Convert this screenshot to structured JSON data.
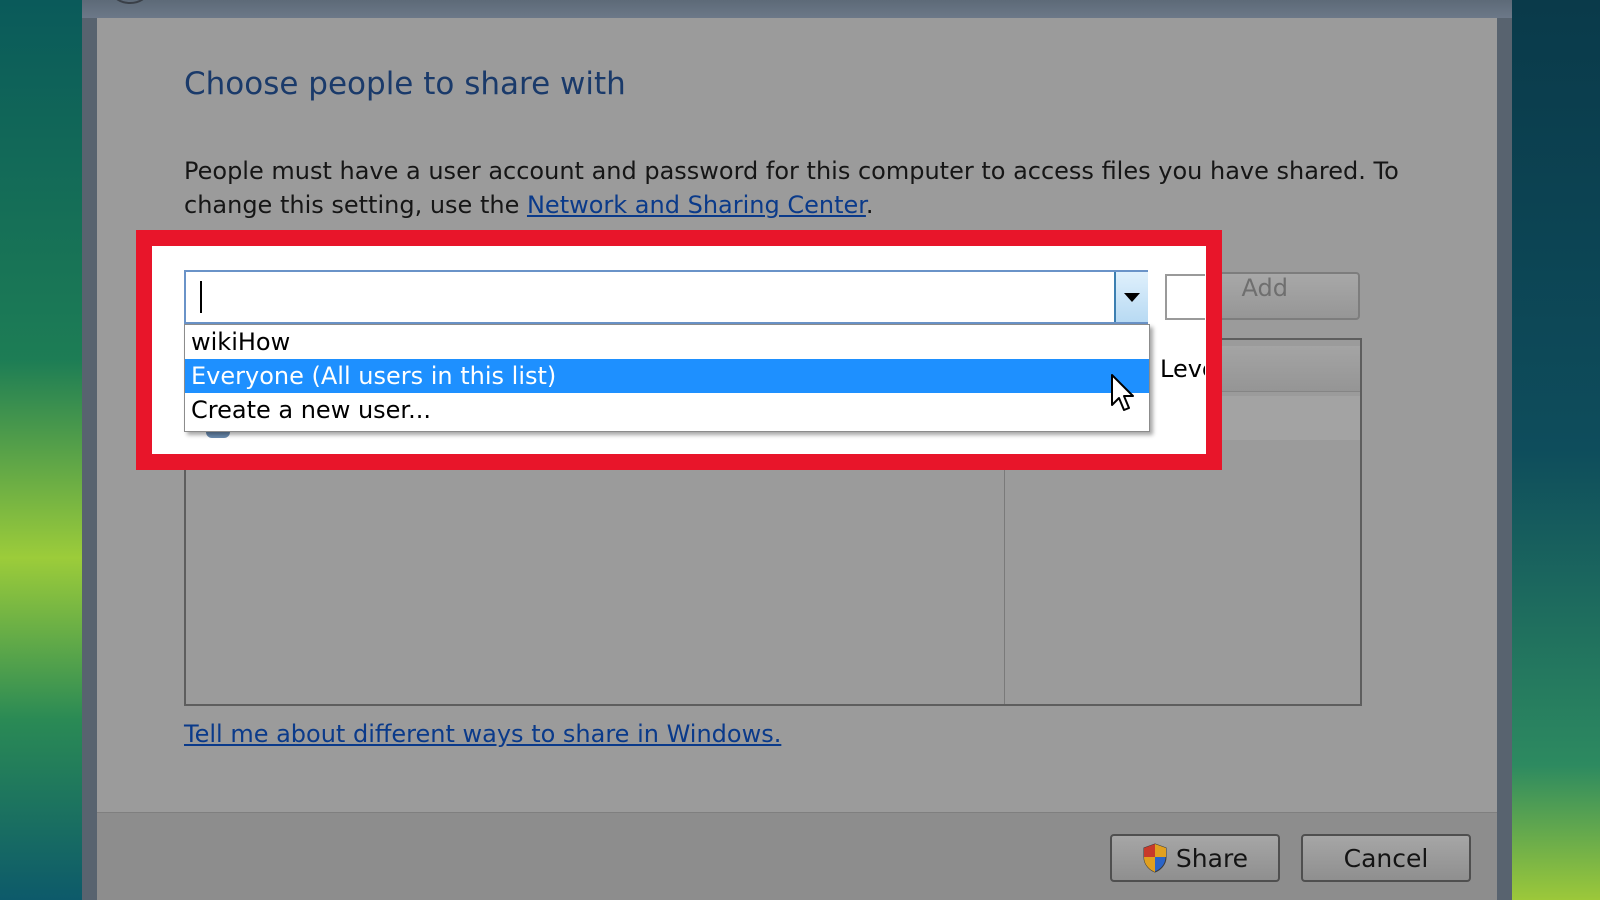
{
  "dialog": {
    "heading": "Choose people to share with",
    "description": "People must have a user account and password for this computer to access files you have shared.  To change this setting, use the ",
    "description_link": "Network and Sharing Center",
    "description_end": ".",
    "add_label": "Add",
    "level_header": "Leve",
    "help_link": "Tell me about different ways to share in Windows.",
    "share_label": "Share",
    "cancel_label": "Cancel"
  },
  "combo": {
    "value": "",
    "options": [
      {
        "label": "wikiHow",
        "selected": false
      },
      {
        "label": "Everyone (All users in this list)",
        "selected": true
      },
      {
        "label": "Create a new user...",
        "selected": false
      }
    ]
  },
  "colors": {
    "highlight": "#e8152a",
    "selection": "#1e90ff",
    "link": "#0a3a8a",
    "heading": "#1a3a6a"
  },
  "icons": {
    "combo_arrow": "chevron-down-icon",
    "share_shield": "uac-shield-icon",
    "cursor": "mouse-pointer-icon"
  }
}
